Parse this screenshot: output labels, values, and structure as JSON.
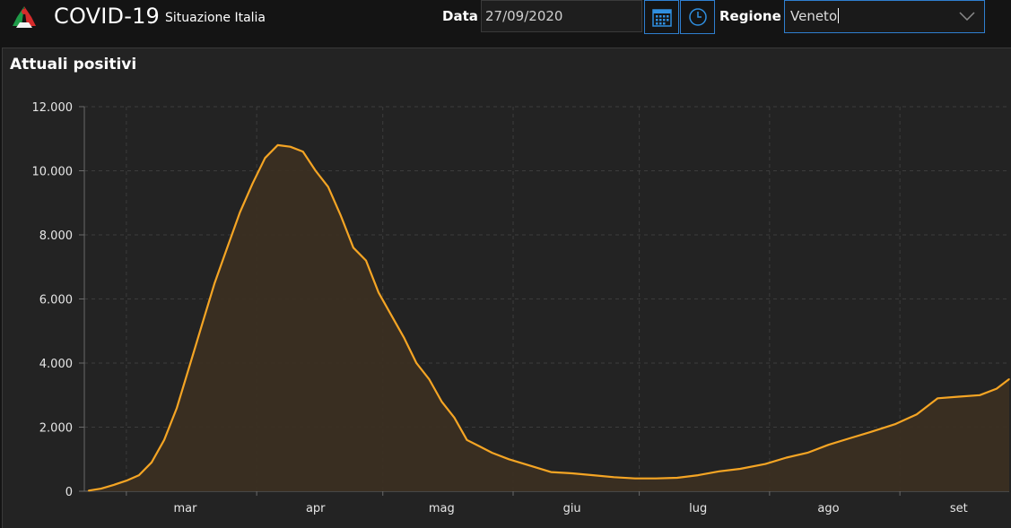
{
  "header": {
    "app_title": "COVID-19",
    "app_subtitle": "Situazione Italia",
    "date_label": "Data",
    "date_value": "27/09/2020",
    "region_label": "Regione",
    "region_value": "Veneto",
    "icons": [
      "calendar-icon",
      "clock-icon",
      "dropdown-arrow-icon"
    ]
  },
  "panel": {
    "title": "Attuali positivi"
  },
  "colors": {
    "line": "#f5a524",
    "fill": "#3b2f22",
    "accent_border": "#2f7fd0"
  },
  "chart_data": {
    "type": "area",
    "title": "Attuali positivi",
    "xlabel": "",
    "ylabel": "",
    "ylim": [
      0,
      12000
    ],
    "yticks": [
      "0",
      "2.000",
      "4.000",
      "6.000",
      "8.000",
      "10.000",
      "12.000"
    ],
    "ytick_values": [
      0,
      2000,
      4000,
      6000,
      8000,
      10000,
      12000
    ],
    "xticks": [
      "mar",
      "apr",
      "mag",
      "giu",
      "lug",
      "ago",
      "set"
    ],
    "xtick_dates": [
      "2020-03-15",
      "2020-04-15",
      "2020-05-15",
      "2020-06-15",
      "2020-07-15",
      "2020-08-15",
      "2020-09-15"
    ],
    "grid": true,
    "series": [
      {
        "dates": [
          "2020-02-21",
          "2020-02-24",
          "2020-02-27",
          "2020-03-01",
          "2020-03-04",
          "2020-03-07",
          "2020-03-10",
          "2020-03-13",
          "2020-03-16",
          "2020-03-19",
          "2020-03-22",
          "2020-03-25",
          "2020-03-28",
          "2020-03-31",
          "2020-04-03",
          "2020-04-06",
          "2020-04-09",
          "2020-04-12",
          "2020-04-15",
          "2020-04-18",
          "2020-04-21",
          "2020-04-24",
          "2020-04-27",
          "2020-04-30",
          "2020-05-03",
          "2020-05-06",
          "2020-05-09",
          "2020-05-12",
          "2020-05-15",
          "2020-05-18",
          "2020-05-21",
          "2020-05-24",
          "2020-05-27",
          "2020-05-31",
          "2020-06-05",
          "2020-06-10",
          "2020-06-15",
          "2020-06-20",
          "2020-06-25",
          "2020-06-30",
          "2020-07-05",
          "2020-07-10",
          "2020-07-15",
          "2020-07-20",
          "2020-07-25",
          "2020-07-31",
          "2020-08-05",
          "2020-08-10",
          "2020-08-15",
          "2020-08-20",
          "2020-08-25",
          "2020-08-31",
          "2020-09-05",
          "2020-09-10",
          "2020-09-15",
          "2020-09-20",
          "2020-09-24",
          "2020-09-27"
        ],
        "values": [
          20,
          80,
          200,
          330,
          500,
          900,
          1600,
          2600,
          3900,
          5200,
          6500,
          7600,
          8700,
          9600,
          10400,
          10800,
          10750,
          10600,
          10000,
          9500,
          8600,
          7600,
          7200,
          6200,
          5500,
          4800,
          4000,
          3500,
          2800,
          2300,
          1600,
          1400,
          1200,
          1000,
          800,
          600,
          560,
          500,
          440,
          400,
          400,
          420,
          500,
          620,
          700,
          850,
          1050,
          1200,
          1450,
          1650,
          1850,
          2100,
          2400,
          2900,
          2950,
          3000,
          3200,
          3500
        ]
      }
    ]
  }
}
